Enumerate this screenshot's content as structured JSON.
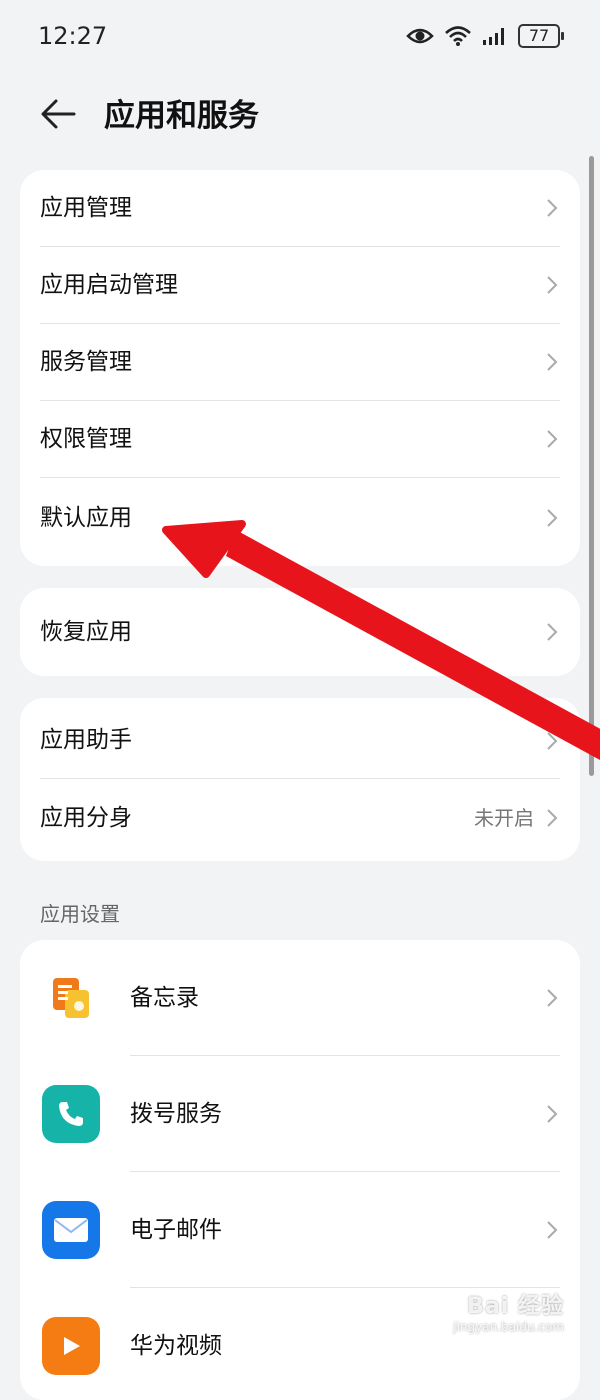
{
  "status_bar": {
    "time": "12:27",
    "battery": "77",
    "icons": [
      "eye-comfort-icon",
      "wifi-icon",
      "signal-icon",
      "battery-icon"
    ]
  },
  "header": {
    "back_icon": "back-arrow-icon",
    "title": "应用和服务"
  },
  "group1": {
    "items": [
      {
        "label": "应用管理"
      },
      {
        "label": "应用启动管理"
      },
      {
        "label": "服务管理"
      },
      {
        "label": "权限管理"
      },
      {
        "label": "默认应用"
      }
    ]
  },
  "group2": {
    "items": [
      {
        "label": "恢复应用"
      }
    ]
  },
  "group3": {
    "items": [
      {
        "label": "应用助手"
      },
      {
        "label": "应用分身",
        "value": "未开启"
      }
    ]
  },
  "app_settings": {
    "section_title": "应用设置",
    "items": [
      {
        "label": "备忘录",
        "icon": "notepad-icon",
        "color": "#f07a1a"
      },
      {
        "label": "拨号服务",
        "icon": "phone-icon",
        "color": "#16b3a8"
      },
      {
        "label": "电子邮件",
        "icon": "mail-icon",
        "color": "#1677e8"
      },
      {
        "label": "华为视频",
        "icon": "video-icon",
        "color": "#f57c12"
      }
    ]
  },
  "annotation": {
    "arrow_color": "#e8141b"
  },
  "watermark": {
    "logo": "Bai 经验",
    "url": "jingyan.baidu.com"
  }
}
